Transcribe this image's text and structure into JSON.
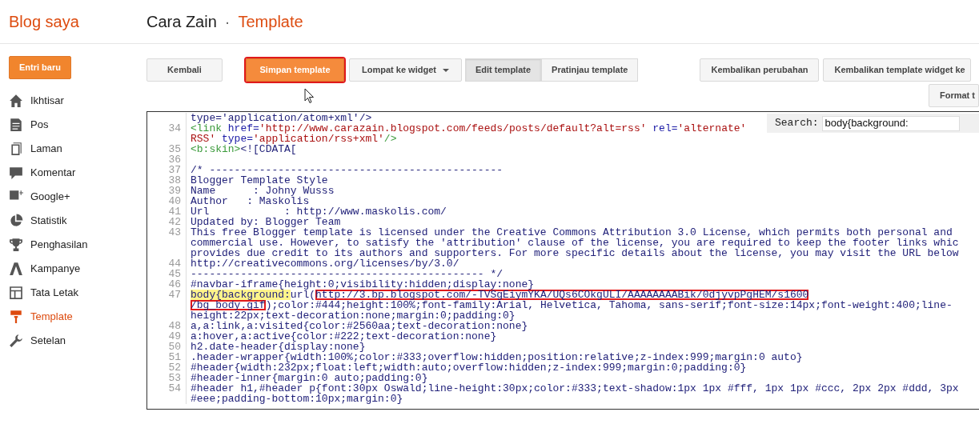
{
  "header": {
    "blog_menu": "Blog saya",
    "blog_name": "Cara Zain",
    "separator": "·",
    "page": "Template"
  },
  "sidebar": {
    "new_post": "Entri baru",
    "items": [
      {
        "label": "Ikhtisar",
        "selected": false
      },
      {
        "label": "Pos",
        "selected": false
      },
      {
        "label": "Laman",
        "selected": false
      },
      {
        "label": "Komentar",
        "selected": false
      },
      {
        "label": "Google+",
        "selected": false
      },
      {
        "label": "Statistik",
        "selected": false
      },
      {
        "label": "Penghasilan",
        "selected": false
      },
      {
        "label": "Kampanye",
        "selected": false
      },
      {
        "label": "Tata Letak",
        "selected": false
      },
      {
        "label": "Template",
        "selected": true
      },
      {
        "label": "Setelan",
        "selected": false
      }
    ]
  },
  "toolbar": {
    "back": "Kembali",
    "save": {
      "label": "Simpan template",
      "outlined": true
    },
    "jump": "Lompat ke widget",
    "tabs": [
      {
        "label": "Edit template",
        "selected": true
      },
      {
        "label": "Pratinjau template",
        "selected": false
      }
    ],
    "revert": "Kembalikan perubahan",
    "revert_widgets": "Kembalikan template widget ke",
    "format": "Format t"
  },
  "editor": {
    "search": {
      "label": "Search:",
      "value": "body{background:"
    },
    "lines": [
      {
        "rows": [
          {
            "text": "type='application/atom+xml'/>"
          }
        ]
      },
      {
        "number": "34",
        "rows": [
          {
            "segments": [
              {
                "kind": "tag",
                "text": "<link "
              },
              {
                "kind": "attr",
                "text": "href="
              },
              {
                "kind": "string",
                "text": "'http://www.carazain.blogspot.com/feeds/posts/default?alt=rss' "
              },
              {
                "kind": "attr",
                "text": "rel="
              },
              {
                "kind": "string",
                "text": "'alternate'"
              }
            ]
          },
          {
            "segments": [
              {
                "kind": "string",
                "text": "RSS' "
              },
              {
                "kind": "attr",
                "text": "type="
              },
              {
                "kind": "string",
                "text": "'application/rss+xml'"
              },
              {
                "kind": "tag",
                "text": "/>"
              }
            ]
          }
        ]
      },
      {
        "number": "35",
        "rows": [
          {
            "segments": [
              {
                "kind": "tag",
                "text": "<b:skin>"
              },
              {
                "kind": "plain",
                "text": "<![CDATA["
              }
            ]
          }
        ]
      },
      {
        "number": "36",
        "rows": [
          {
            "text": ""
          }
        ]
      },
      {
        "number": "37",
        "rows": [
          {
            "text": "/* -----------------------------------------------"
          }
        ]
      },
      {
        "number": "38",
        "rows": [
          {
            "text": "Blogger Template Style"
          }
        ]
      },
      {
        "number": "39",
        "rows": [
          {
            "text": "Name      : Johny Wusss"
          }
        ]
      },
      {
        "number": "40",
        "rows": [
          {
            "text": "Author   : Maskolis"
          }
        ]
      },
      {
        "number": "41",
        "rows": [
          {
            "text": "Url            : http://www.maskolis.com/"
          }
        ]
      },
      {
        "number": "42",
        "rows": [
          {
            "text": "Updated by: Blogger Team"
          }
        ]
      },
      {
        "number": "43",
        "rows": [
          {
            "text": "This free Blogger template is licensed under the Creative Commons Attribution 3.0 License, which permits both personal and"
          },
          {
            "text": "commercial use. However, to satisfy the 'attribution' clause of the license, you are required to keep the footer links whic"
          },
          {
            "text": "provides due credit to its authors and supporters. For more specific details about the license, you may visit the URL below"
          }
        ]
      },
      {
        "number": "44",
        "rows": [
          {
            "text": "http://creativecommons.org/licenses/by/3.0/"
          }
        ]
      },
      {
        "number": "45",
        "rows": [
          {
            "text": "----------------------------------------------- */"
          }
        ]
      },
      {
        "number": "46",
        "rows": [
          {
            "text": "#navbar-iframe{height:0;visibility:hidden;display:none}"
          }
        ]
      },
      {
        "number": "47",
        "rows": [
          {
            "segments": [
              {
                "kind": "highlight",
                "text": "body{background:"
              },
              {
                "kind": "plain",
                "text": "url("
              },
              {
                "kind": "boxed",
                "text": "http://3.bp.blogspot.com/-TVSgEiymYKA/UQs6COkgULI/AAAAAAAABik/0djyvpPgHEM/s1600"
              }
            ]
          },
          {
            "segments": [
              {
                "kind": "boxed",
                "text": "/bg_body.gif"
              },
              {
                "kind": "plain",
                "text": ");color:#444;height:100%;font-family:Arial, Helvetica, Tahoma, sans-serif;font-size:14px;font-weight:400;line-"
              }
            ]
          },
          {
            "text": "height:22px;text-decoration:none;margin:0;padding:0}"
          }
        ]
      },
      {
        "number": "48",
        "rows": [
          {
            "text": "a,a:link,a:visited{color:#2560aa;text-decoration:none}"
          }
        ]
      },
      {
        "number": "49",
        "rows": [
          {
            "text": "a:hover,a:active{color:#222;text-decoration:none}"
          }
        ]
      },
      {
        "number": "50",
        "rows": [
          {
            "text": "h2.date-header{display:none}"
          }
        ]
      },
      {
        "number": "51",
        "rows": [
          {
            "text": ".header-wrapper{width:100%;color:#333;overflow:hidden;position:relative;z-index:999;margin:0 auto}"
          }
        ]
      },
      {
        "number": "52",
        "rows": [
          {
            "text": "#header{width:232px;float:left;width:auto;overflow:hidden;z-index:999;margin:0;padding:0}"
          }
        ]
      },
      {
        "number": "53",
        "rows": [
          {
            "text": "#header-inner{margin:0 auto;padding:0}"
          }
        ]
      },
      {
        "number": "54",
        "rows": [
          {
            "text": "#header h1,#header p{font:30px Oswald;line-height:30px;color:#333;text-shadow:1px 1px #fff, 1px 1px #ccc, 2px 2px #ddd, 3px"
          },
          {
            "text": "#eee;padding-bottom:10px;margin:0}"
          }
        ]
      }
    ]
  }
}
